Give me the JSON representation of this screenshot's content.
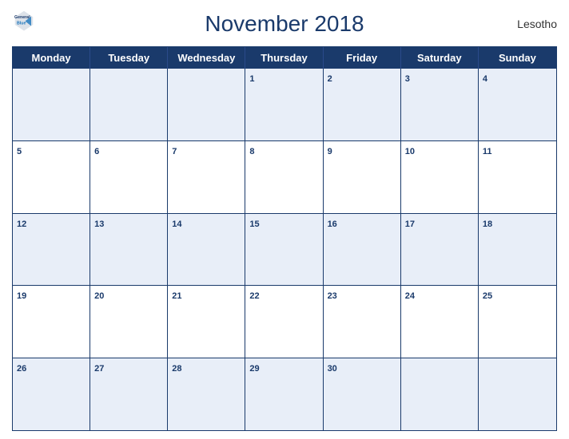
{
  "header": {
    "title": "November 2018",
    "country": "Lesotho",
    "logo_general": "General",
    "logo_blue": "Blue"
  },
  "days_of_week": [
    "Monday",
    "Tuesday",
    "Wednesday",
    "Thursday",
    "Friday",
    "Saturday",
    "Sunday"
  ],
  "weeks": [
    [
      {
        "day": "",
        "empty": true
      },
      {
        "day": "",
        "empty": true
      },
      {
        "day": "",
        "empty": true
      },
      {
        "day": "1",
        "empty": false
      },
      {
        "day": "2",
        "empty": false
      },
      {
        "day": "3",
        "empty": false
      },
      {
        "day": "4",
        "empty": false
      }
    ],
    [
      {
        "day": "5",
        "empty": false
      },
      {
        "day": "6",
        "empty": false
      },
      {
        "day": "7",
        "empty": false
      },
      {
        "day": "8",
        "empty": false
      },
      {
        "day": "9",
        "empty": false
      },
      {
        "day": "10",
        "empty": false
      },
      {
        "day": "11",
        "empty": false
      }
    ],
    [
      {
        "day": "12",
        "empty": false
      },
      {
        "day": "13",
        "empty": false
      },
      {
        "day": "14",
        "empty": false
      },
      {
        "day": "15",
        "empty": false
      },
      {
        "day": "16",
        "empty": false
      },
      {
        "day": "17",
        "empty": false
      },
      {
        "day": "18",
        "empty": false
      }
    ],
    [
      {
        "day": "19",
        "empty": false
      },
      {
        "day": "20",
        "empty": false
      },
      {
        "day": "21",
        "empty": false
      },
      {
        "day": "22",
        "empty": false
      },
      {
        "day": "23",
        "empty": false
      },
      {
        "day": "24",
        "empty": false
      },
      {
        "day": "25",
        "empty": false
      }
    ],
    [
      {
        "day": "26",
        "empty": false
      },
      {
        "day": "27",
        "empty": false
      },
      {
        "day": "28",
        "empty": false
      },
      {
        "day": "29",
        "empty": false
      },
      {
        "day": "30",
        "empty": false
      },
      {
        "day": "",
        "empty": true
      },
      {
        "day": "",
        "empty": true
      }
    ]
  ],
  "accent_color": "#1a3a6b"
}
